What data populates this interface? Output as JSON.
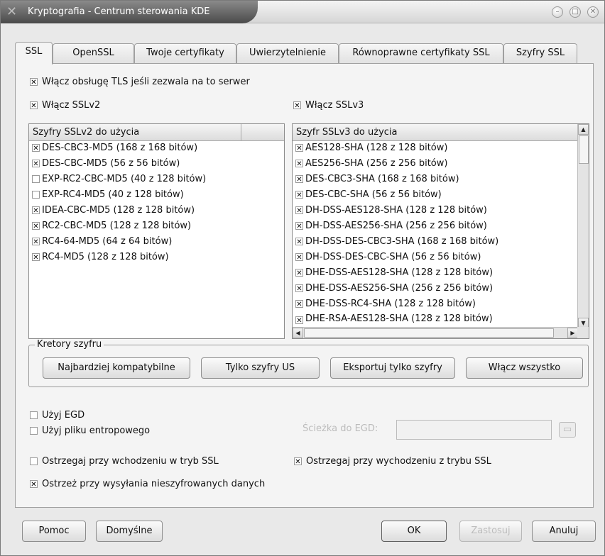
{
  "window": {
    "title": "Kryptografia - Centrum sterowania KDE",
    "logo_icon": "kde-x-logo-icon",
    "buttons": [
      {
        "name": "minimize-icon",
        "glyph": "–"
      },
      {
        "name": "maximize-icon",
        "glyph": "□"
      },
      {
        "name": "close-icon",
        "glyph": "✕"
      }
    ]
  },
  "tabs": [
    {
      "label": "SSL",
      "active": true
    },
    {
      "label": "OpenSSL"
    },
    {
      "label": "Twoje certyfikaty"
    },
    {
      "label": "Uwierzytelnienie"
    },
    {
      "label": "Równoprawne certyfikaty SSL"
    },
    {
      "label": "Szyfry SSL"
    }
  ],
  "ssl": {
    "tls": {
      "label": "Włącz obsługę TLS jeśli zezwala na to serwer",
      "checked": true
    },
    "sslv2": {
      "label": "Włącz SSLv2",
      "checked": true
    },
    "sslv3": {
      "label": "Włącz SSLv3",
      "checked": true
    },
    "v2_list": {
      "header": "Szyfry SSLv2 do użycia",
      "items": [
        {
          "label": "DES-CBC3-MD5 (168 z 168 bitów)",
          "checked": true
        },
        {
          "label": "DES-CBC-MD5 (56 z 56 bitów)",
          "checked": true
        },
        {
          "label": "EXP-RC2-CBC-MD5 (40 z 128 bitów)",
          "checked": false
        },
        {
          "label": "EXP-RC4-MD5 (40 z 128 bitów)",
          "checked": false
        },
        {
          "label": "IDEA-CBC-MD5 (128 z 128 bitów)",
          "checked": true
        },
        {
          "label": "RC2-CBC-MD5 (128 z 128 bitów)",
          "checked": true
        },
        {
          "label": "RC4-64-MD5 (64 z 64 bitów)",
          "checked": true
        },
        {
          "label": "RC4-MD5 (128 z 128 bitów)",
          "checked": true
        }
      ]
    },
    "v3_list": {
      "header": "Szyfr SSLv3 do użycia",
      "items": [
        {
          "label": "AES128-SHA (128 z 128 bitów)",
          "checked": true
        },
        {
          "label": "AES256-SHA (256 z 256 bitów)",
          "checked": true
        },
        {
          "label": "DES-CBC3-SHA (168 z 168 bitów)",
          "checked": true
        },
        {
          "label": "DES-CBC-SHA (56 z 56 bitów)",
          "checked": true
        },
        {
          "label": "DH-DSS-AES128-SHA (128 z 128 bitów)",
          "checked": true
        },
        {
          "label": "DH-DSS-AES256-SHA (256 z 256 bitów)",
          "checked": true
        },
        {
          "label": "DH-DSS-DES-CBC3-SHA (168 z 168 bitów)",
          "checked": true
        },
        {
          "label": "DH-DSS-DES-CBC-SHA (56 z 56 bitów)",
          "checked": true
        },
        {
          "label": "DHE-DSS-AES128-SHA (128 z 128 bitów)",
          "checked": true
        },
        {
          "label": "DHE-DSS-AES256-SHA (256 z 256 bitów)",
          "checked": true
        },
        {
          "label": "DHE-DSS-RC4-SHA (128 z 128 bitów)",
          "checked": true
        },
        {
          "label": "DHE-RSA-AES128-SHA (128 z 128 bitów)",
          "checked": true
        }
      ]
    },
    "wizard": {
      "title": "Kretory szyfru",
      "buttons": [
        "Najbardziej kompatybilne",
        "Tylko szyfry US",
        "Eksportuj tylko szyfry",
        "Włącz wszystko"
      ]
    },
    "egd": {
      "label": "Użyj EGD",
      "checked": false
    },
    "entropy": {
      "label": "Użyj pliku entropowego",
      "checked": false
    },
    "egd_path_label": "Ścieżka do EGD:",
    "folder_icon": "folder-open-icon",
    "warn_enter": {
      "label": "Ostrzegaj przy wchodzeniu w tryb SSL",
      "checked": false
    },
    "warn_leave": {
      "label": "Ostrzegaj przy wychodzeniu z trybu SSL",
      "checked": true
    },
    "warn_unencrypted": {
      "label": "Ostrzeż przy wysyłania nieszyfrowanych danych",
      "checked": true
    }
  },
  "footer": {
    "help": "Pomoc",
    "defaults": "Domyślne",
    "ok": "OK",
    "apply": "Zastosuj",
    "cancel": "Anuluj"
  }
}
